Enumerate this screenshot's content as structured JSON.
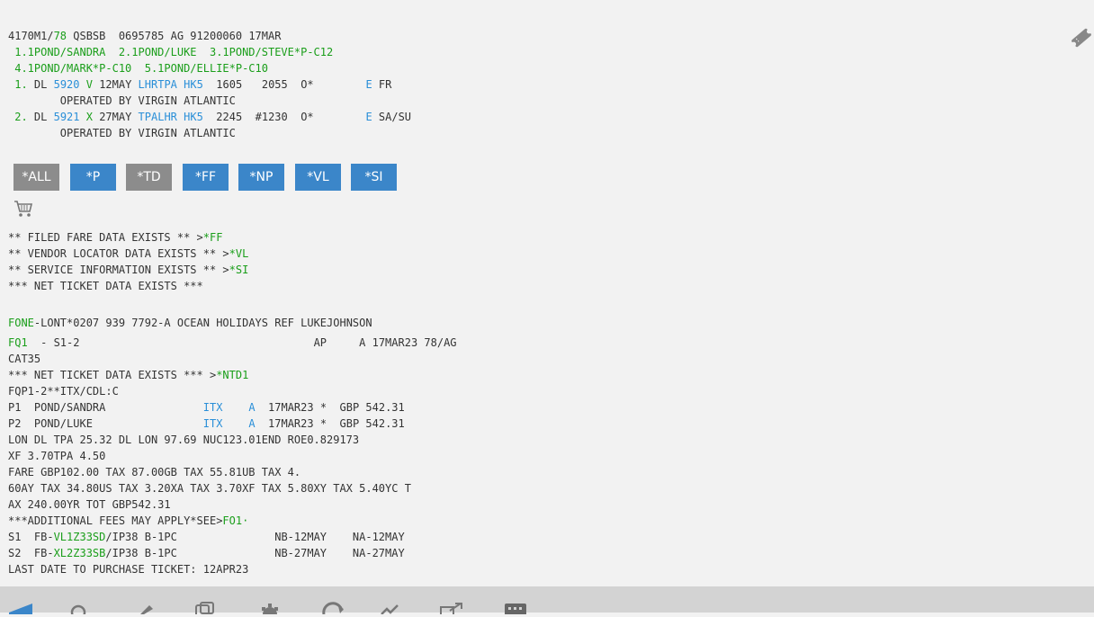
{
  "header": {
    "record_line": "4170M1/",
    "record_num": "78",
    "record_rest": " QSBSB  0695785 AG 91200060 17MAR"
  },
  "passengers": {
    "line1": " 1.1POND/SANDRA  2.1POND/LUKE  3.1POND/STEVE*P-C12",
    "line2": " 4.1POND/MARK*P-C10  5.1POND/ELLIE*P-C10"
  },
  "segments": [
    {
      "num": " 1.",
      "carrier": " DL ",
      "flight": "5920",
      "space1": " ",
      "class": "V",
      "date": " 12MAY ",
      "route": "LHRTPA",
      "space2": " ",
      "status": "HK5",
      "times": "  1605   2055  O*        ",
      "e": "E",
      "days": " FR",
      "operated": "        OPERATED BY VIRGIN ATLANTIC"
    },
    {
      "num": " 2.",
      "carrier": " DL ",
      "flight": "5921",
      "space1": " ",
      "class": "X",
      "date": " 27MAY ",
      "route": "TPALHR",
      "space2": " ",
      "status": "HK5",
      "times": "  2245  #1230  O*        ",
      "e": "E",
      "days": " SA/SU",
      "operated": "        OPERATED BY VIRGIN ATLANTIC"
    }
  ],
  "buttons": [
    {
      "label": "*ALL",
      "style": "gray"
    },
    {
      "label": "*P",
      "style": "blue"
    },
    {
      "label": "*TD",
      "style": "gray"
    },
    {
      "label": "*FF",
      "style": "blue"
    },
    {
      "label": "*NP",
      "style": "blue"
    },
    {
      "label": "*VL",
      "style": "blue"
    },
    {
      "label": "*SI",
      "style": "blue"
    }
  ],
  "notices": {
    "ff_text": "** FILED FARE DATA EXISTS ** >",
    "ff_link": "*FF",
    "vl_text": "** VENDOR LOCATOR DATA EXISTS ** >",
    "vl_link": "*VL",
    "si_text": "** SERVICE INFORMATION EXISTS ** >",
    "si_link": "*SI",
    "net": "*** NET TICKET DATA EXISTS ***"
  },
  "fone": {
    "label": "FONE",
    "text": "-LONT*0207 939 7792-A OCEAN HOLIDAYS REF LUKEJOHNSON"
  },
  "fare": {
    "fq_label": "FQ1",
    "fq_rest": "  - S1-2                                    AP     A 17MAR23 78/AG",
    "cat": "CAT35",
    "net_text": "*** NET TICKET DATA EXISTS *** >",
    "net_link": "*NTD1",
    "fqp": "FQP1-2**ITX/CDL:C",
    "pax": [
      {
        "pre": "P1  POND/SANDRA               ",
        "itx": "ITX",
        "mid": "    ",
        "a": "A",
        "post": "  17MAR23 *  GBP 542.31"
      },
      {
        "pre": "P2  POND/LUKE                 ",
        "itx": "ITX",
        "mid": "    ",
        "a": "A",
        "post": "  17MAR23 *  GBP 542.31"
      }
    ],
    "calc1": "LON DL TPA 25.32 DL LON 97.69 NUC123.01END ROE0.829173",
    "calc2": "XF 3.70TPA 4.50",
    "calc3": "FARE GBP102.00 TAX 87.00GB TAX 55.81UB TAX 4.",
    "calc4": "60AY TAX 34.80US TAX 3.20XA TAX 3.70XF TAX 5.80XY TAX 5.40YC T",
    "calc5": "AX 240.00YR TOT GBP542.31",
    "addl_text": "***ADDITIONAL FEES MAY APPLY*SEE>",
    "addl_link": "FO1·",
    "s1_pre": "S1  FB-",
    "s1_fb": "VL1Z33SD",
    "s1_post": "/IP38 B-1PC               NB-12MAY    NA-12MAY",
    "s2_pre": "S2  FB-",
    "s2_fb": "XL2Z33SB",
    "s2_post": "/IP38 B-1PC               NB-27MAY    NA-27MAY",
    "last_date": "LAST DATE TO PURCHASE TICKET: 12APR23"
  },
  "toolbar_icons": [
    "send-icon",
    "search-icon",
    "edit-icon",
    "copy-icon",
    "settings-icon",
    "refresh-icon",
    "chart-icon",
    "external-link-icon",
    "keyboard-icon"
  ],
  "colors": {
    "green": "#1a9e1a",
    "blue": "#2a8fd8",
    "button_blue": "#3b86c9",
    "button_gray": "#8c8c8c"
  }
}
